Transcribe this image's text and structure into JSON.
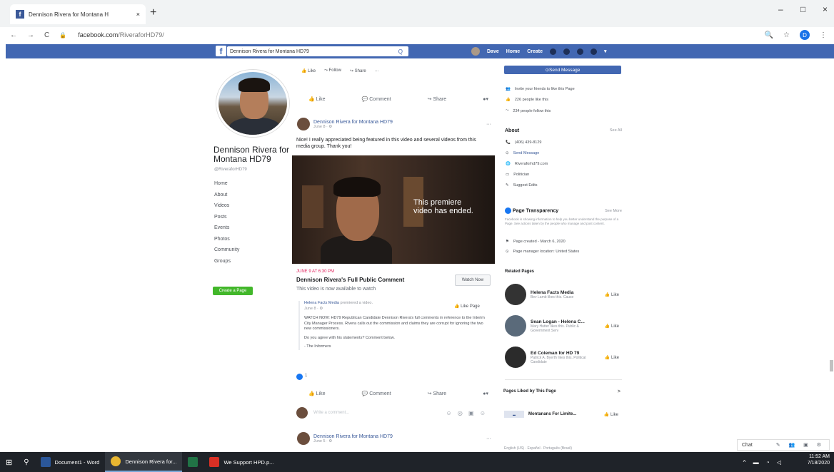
{
  "browser": {
    "tab_title": "Dennison Rivera for Montana H",
    "tab_close": "×",
    "new_tab": "+",
    "url_host": "facebook.com",
    "url_path": "/RiveraforHD79/",
    "back": "←",
    "forward": "→",
    "reload": "C",
    "lock": "🔒",
    "minimize": "–",
    "maximize": "□",
    "close": "×",
    "profile_initial": "D",
    "search_glyph": "🔍",
    "star_glyph": "☆",
    "menu_glyph": "⋮"
  },
  "fb_header": {
    "logo": "f",
    "search_value": "Dennison Rivera for Montana HD79",
    "search_glyph": "Q",
    "user": "Dave",
    "home": "Home",
    "create": "Create"
  },
  "left": {
    "page_name": "Dennison Rivera for Montana HD79",
    "handle": "@RiveraforHD79",
    "nav": [
      "Home",
      "About",
      "Videos",
      "Posts",
      "Events",
      "Photos",
      "Community",
      "Groups"
    ],
    "create_page": "Create a Page"
  },
  "sticky_actions": [
    "Like",
    "Follow",
    "Share",
    "…"
  ],
  "post_actions": {
    "like": "Like",
    "comment": "Comment",
    "share": "Share"
  },
  "post1": {
    "author": "Dennison Rivera for Montana HD79",
    "date": "June 8 · ⚙",
    "text": "Nice! I really appreciated being featured in this video and several videos from this media group. Thank you!",
    "premiere_line1": "This premiere",
    "premiere_line2": "video has ended.",
    "live_label": "JUNE 9 AT 6:30 PM",
    "video_title": "Dennison Rivera's Full Public Comment",
    "video_sub": "This video is now available to watch",
    "watch_now": "Watch Now",
    "shared_author": "Helena Facts Media",
    "shared_meta": "premiered a video.",
    "shared_date": "June 8 · ⚙",
    "like_page": "Like Page",
    "shared_text": "WATCH NOW: HD79 Republican Candidate Dennison Rivera's full comments in reference to the Interim City Manager Process. Rivera calls out the commission and claims they are corrupt for ignoring the two new commissioners.",
    "shared_question": "Do you agree with his statements? Comment below.",
    "shared_sign": "- The Informers",
    "reaction_count": "1",
    "comment_placeholder": "Write a comment...",
    "comment_icons": "☺ ◎ ▣ ☺"
  },
  "post2": {
    "author": "Dennison Rivera for Montana HD79",
    "date": "June 5 · ⚙"
  },
  "right": {
    "send_message": "Send Message",
    "invite": "Invite your friends to like this Page",
    "likes": "226 people like this",
    "follows": "234 people follow this",
    "about_title": "About",
    "see_all": "See All",
    "phone": "(406) 439-8129",
    "send_msg_link": "Send Message",
    "website": "Riveraforhd79.com",
    "category": "Politician",
    "suggest": "Suggest Edits",
    "transparency_title": "Page Transparency",
    "see_more": "See More",
    "transparency_text": "Facebook is showing information to help you better understand the purpose of a Page. See actions taken by the people who manage and post content.",
    "page_created": "Page created - March 6, 2020",
    "manager_loc": "Page manager location: United States",
    "related_title": "Related Pages",
    "related": [
      {
        "name": "Helena Facts Media",
        "sub": "Bev Lamb likes this. Cause",
        "like": "Like"
      },
      {
        "name": "Sean Logan - Helena C...",
        "sub": "Mary Hutter likes this. Public & Government Serv",
        "like": "Like"
      },
      {
        "name": "Ed Coleman for HD 79",
        "sub": "Patrick A. Byerth likes this. Political Candidate",
        "like": "Like"
      }
    ],
    "liked_by_title": "Pages Liked by This Page",
    "liked_by_chevron": ">",
    "liked_page": "Montanans For Limite...",
    "liked_like": "Like",
    "languages": "English (US) · Español · Português (Brasil)"
  },
  "chat": {
    "label": "Chat"
  },
  "taskbar": {
    "items": [
      {
        "label": "Document1 - Word",
        "color": "#2b579a"
      },
      {
        "label": "Dennison Rivera for...",
        "color": "#e8b631"
      },
      {
        "label": "",
        "color": "#217346"
      },
      {
        "label": "We Support HPD.p...",
        "color": "#d93025"
      }
    ],
    "time": "11:52 AM",
    "date": "7/18/2020"
  }
}
